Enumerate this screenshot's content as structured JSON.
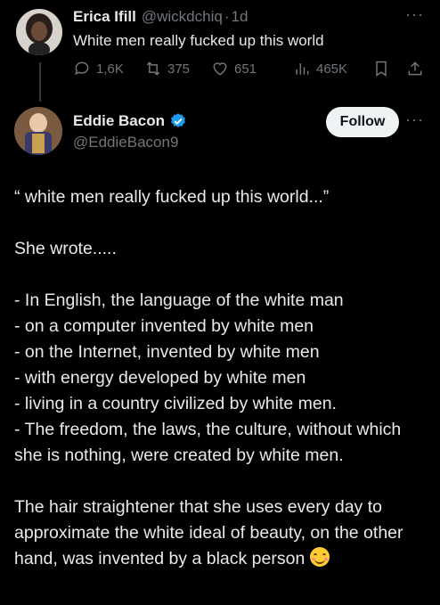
{
  "reply_to": {
    "display_name": "Erica Ifill",
    "handle": "@wickdchiq",
    "separator": "·",
    "age": "1d",
    "text": "White men really fucked up this world",
    "stats": {
      "replies": "1,6K",
      "reposts": "375",
      "likes": "651",
      "views": "465K"
    },
    "more": "···"
  },
  "main_post": {
    "display_name": "Eddie Bacon",
    "handle": "@EddieBacon9",
    "follow_label": "Follow",
    "more": "···",
    "body": {
      "quote": "“ white men really fucked up this world...”",
      "intro": "She wrote.....",
      "list": [
        "- In English, the language of the white man",
        "- on  a computer invented by white men",
        "- on the Internet, invented by white men",
        "-  with energy developed by white men",
        "- living  in a country civilized by white men.",
        "- The freedom, the laws, the culture, without which she is nothing, were created by white men."
      ],
      "closing": "The hair straightener that she uses every day to approximate the white ideal of beauty, on the other hand, was invented by a black person"
    }
  },
  "colors": {
    "background": "#000000",
    "text": "#e7e9ea",
    "muted": "#71767b",
    "verified": "#1d9bf0",
    "follow_bg": "#eff3f4"
  }
}
